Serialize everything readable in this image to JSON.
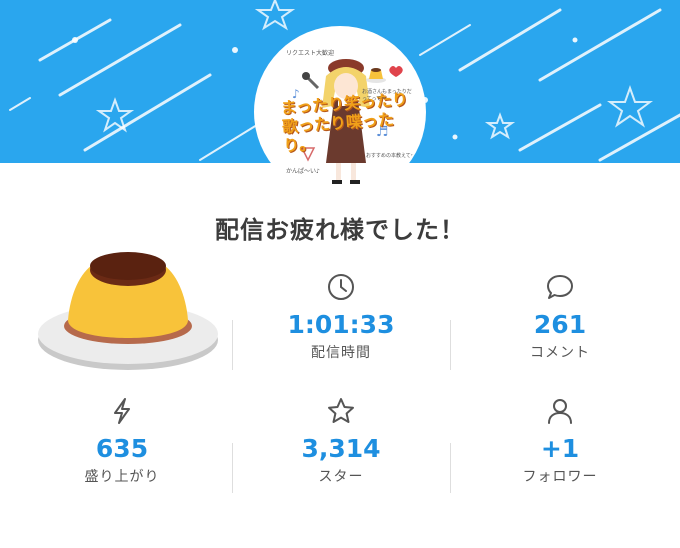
{
  "headline": "配信お疲れ様でした！",
  "avatar": {
    "title": "まったり笑ったり歌ったり喋ったり。",
    "caption_top": "リクエスト大歓迎",
    "caption_right": "お酒さんもまったりだってって〜",
    "caption_left": "かんぱ〜い♪",
    "caption_bottom": "おすすめの本教えて〜"
  },
  "stats": [
    {
      "icon": "clock-icon",
      "value": "1:01:33",
      "label": "配信時間"
    },
    {
      "icon": "comment-icon",
      "value": "261",
      "label": "コメント"
    },
    {
      "icon": "lightning-icon",
      "value": "635",
      "label": "盛り上がり"
    },
    {
      "icon": "star-icon",
      "value": "3,314",
      "label": "スター"
    },
    {
      "icon": "user-icon",
      "value": "+1",
      "label": "フォロワー"
    }
  ],
  "colors": {
    "banner": "#2aa6ee",
    "value": "#1e8fe0",
    "headline": "#3c3c3c"
  }
}
